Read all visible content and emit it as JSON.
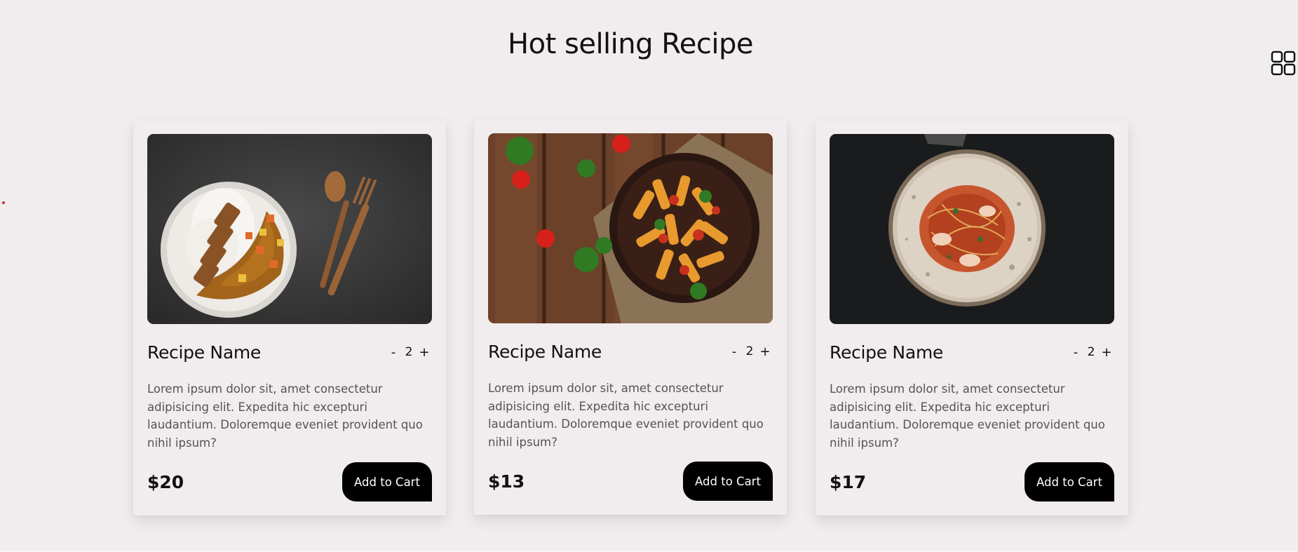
{
  "page": {
    "title": "Hot selling Recipe"
  },
  "icons": {
    "grid": "grid-icon"
  },
  "cards": [
    {
      "image": "curry-rice-dish",
      "name": "Recipe Name",
      "quantity": "2",
      "decrement": "-",
      "increment": "+",
      "description": "Lorem ipsum dolor sit, amet consectetur adipisicing elit. Expedita hic excepturi laudantium. Doloremque eveniet provident quo nihil ipsum?",
      "price": "$20",
      "button": "Add to Cart"
    },
    {
      "image": "penne-pasta-dish",
      "name": "Recipe Name",
      "quantity": "2",
      "decrement": "-",
      "increment": "+",
      "description": "Lorem ipsum dolor sit, amet consectetur adipisicing elit. Expedita hic excepturi laudantium. Doloremque eveniet provident quo nihil ipsum?",
      "price": "$13",
      "button": "Add to Cart"
    },
    {
      "image": "shrimp-spaghetti-dish",
      "name": "Recipe Name",
      "quantity": "2",
      "decrement": "-",
      "increment": "+",
      "description": "Lorem ipsum dolor sit, amet consectetur adipisicing elit. Expedita hic excepturi laudantium. Doloremque eveniet provident quo nihil ipsum?",
      "price": "$17",
      "button": "Add to Cart"
    }
  ],
  "colors": {
    "background": "#f1eced",
    "button": "#000000",
    "button_text": "#ffffff",
    "description_text": "#545454"
  }
}
